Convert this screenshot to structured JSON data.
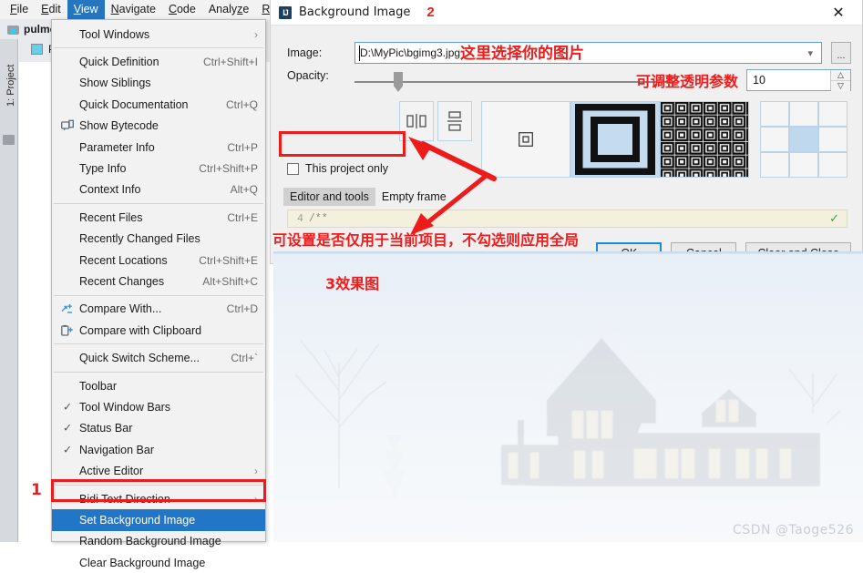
{
  "ide": {
    "menubar": [
      {
        "label": "File",
        "mnemonic": "F"
      },
      {
        "label": "Edit",
        "mnemonic": "E"
      },
      {
        "label": "View",
        "mnemonic": "V",
        "active": true
      },
      {
        "label": "Navigate",
        "mnemonic": "N"
      },
      {
        "label": "Code",
        "mnemonic": "C"
      },
      {
        "label": "Analyze",
        "mnemonic": "z"
      },
      {
        "label": "Refac",
        "mnemonic": "R"
      }
    ],
    "project_name": "pulmon",
    "project_tab": "Project",
    "tool_window_label": "1: Project"
  },
  "view_menu": {
    "items": [
      {
        "label": "Tool Windows",
        "shortcut": "",
        "submenu": true,
        "check": false,
        "sep_after": true
      },
      {
        "label": "Quick Definition",
        "shortcut": "Ctrl+Shift+I",
        "submenu": false,
        "check": false
      },
      {
        "label": "Show Siblings",
        "shortcut": "",
        "submenu": false,
        "check": false
      },
      {
        "label": "Quick Documentation",
        "shortcut": "Ctrl+Q",
        "submenu": false,
        "check": false
      },
      {
        "label": "Show Bytecode",
        "shortcut": "",
        "submenu": false,
        "check": false,
        "icon": "bytecode-icon"
      },
      {
        "label": "Parameter Info",
        "shortcut": "Ctrl+P",
        "submenu": false,
        "check": false
      },
      {
        "label": "Type Info",
        "shortcut": "Ctrl+Shift+P",
        "submenu": false,
        "check": false
      },
      {
        "label": "Context Info",
        "shortcut": "Alt+Q",
        "submenu": false,
        "check": false,
        "sep_after": true
      },
      {
        "label": "Recent Files",
        "shortcut": "Ctrl+E",
        "submenu": false,
        "check": false
      },
      {
        "label": "Recently Changed Files",
        "shortcut": "",
        "submenu": false,
        "check": false
      },
      {
        "label": "Recent Locations",
        "shortcut": "Ctrl+Shift+E",
        "submenu": false,
        "check": false
      },
      {
        "label": "Recent Changes",
        "shortcut": "Alt+Shift+C",
        "submenu": false,
        "check": false,
        "sep_after": true
      },
      {
        "label": "Compare With...",
        "shortcut": "Ctrl+D",
        "submenu": false,
        "check": false,
        "icon": "compare-icon"
      },
      {
        "label": "Compare with Clipboard",
        "shortcut": "",
        "submenu": false,
        "check": false,
        "icon": "clipboard-compare-icon",
        "sep_after": true
      },
      {
        "label": "Quick Switch Scheme...",
        "shortcut": "Ctrl+`",
        "submenu": false,
        "check": false,
        "sep_after": true
      },
      {
        "label": "Toolbar",
        "shortcut": "",
        "submenu": false,
        "check": false
      },
      {
        "label": "Tool Window Bars",
        "shortcut": "",
        "submenu": false,
        "check": true
      },
      {
        "label": "Status Bar",
        "shortcut": "",
        "submenu": false,
        "check": true
      },
      {
        "label": "Navigation Bar",
        "shortcut": "",
        "submenu": false,
        "check": true
      },
      {
        "label": "Active Editor",
        "shortcut": "",
        "submenu": true,
        "check": false,
        "sep_after": true
      },
      {
        "label": "Bidi Text Direction",
        "shortcut": "",
        "submenu": true,
        "check": false
      },
      {
        "label": "Set Background Image",
        "shortcut": "",
        "submenu": false,
        "check": false,
        "selected": true
      },
      {
        "label": "Random Background Image",
        "shortcut": "",
        "submenu": false,
        "check": false
      },
      {
        "label": "Clear Background Image",
        "shortcut": "",
        "submenu": false,
        "check": false
      }
    ]
  },
  "dialog": {
    "title": "Background Image",
    "icon": "intellij-idea-icon",
    "close_icon": "close-icon",
    "image_label": "Image:",
    "image_value": "D:\\MyPic\\bgimg3.jpg",
    "browse_label": "...",
    "opacity_label": "Opacity:",
    "opacity_value": "10",
    "this_project_only_label": "This project only",
    "this_project_only_checked": false,
    "tabs": [
      {
        "label": "Editor and tools",
        "active": true
      },
      {
        "label": "Empty frame",
        "active": false
      }
    ],
    "code_preview": {
      "line_number": "4",
      "text": "/**"
    },
    "buttons": [
      {
        "label": "OK",
        "primary": true
      },
      {
        "label": "Cancel",
        "primary": false
      },
      {
        "label": "Clear and Close",
        "primary": false
      }
    ],
    "fill_options": [
      "center",
      "scale",
      "tile"
    ],
    "fill_selected": "scale",
    "flip_options": [
      "flip-horizontal",
      "flip-vertical"
    ],
    "anchor_selected": "center"
  },
  "annotations": {
    "step1": "1",
    "step2": "2",
    "image_hint": "这里选择你的图片",
    "opacity_hint": "可调整透明参数",
    "project_only_hint": "可设置是否仅用于当前项目，不勾选则应用全局",
    "effect_hint": "3效果图",
    "color": "#f01c1c"
  },
  "watermark": "CSDN @Taoge526"
}
